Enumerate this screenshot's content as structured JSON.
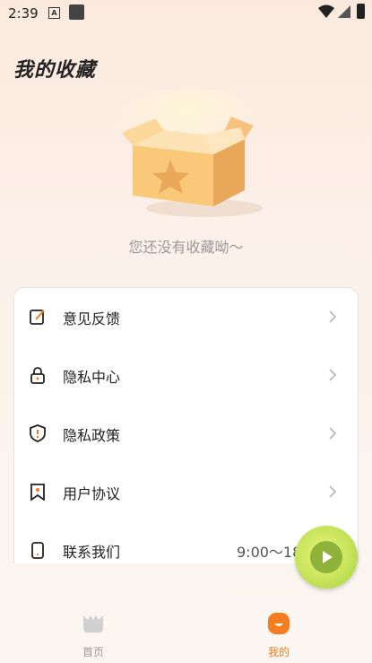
{
  "status_bar": {
    "time": "2:39",
    "notification_letter": "A"
  },
  "page": {
    "title": "我的收藏",
    "empty_message": "您还没有收藏呦～"
  },
  "menu": [
    {
      "label": "意见反馈",
      "icon": "feedback-edit-icon"
    },
    {
      "label": "隐私中心",
      "icon": "lock-icon"
    },
    {
      "label": "隐私政策",
      "icon": "shield-icon"
    },
    {
      "label": "用户协议",
      "icon": "bookmark-doc-icon"
    },
    {
      "label": "联系我们",
      "icon": "phone-icon",
      "extra": "9:00～18"
    }
  ],
  "tabs": [
    {
      "label": "首页",
      "active": false,
      "icon": "home-cat-icon"
    },
    {
      "label": "我的",
      "active": true,
      "icon": "profile-face-icon"
    }
  ],
  "colors": {
    "accent": "#f57c1f",
    "inactive": "#9a9a9a",
    "background": "#fbe9dd"
  }
}
